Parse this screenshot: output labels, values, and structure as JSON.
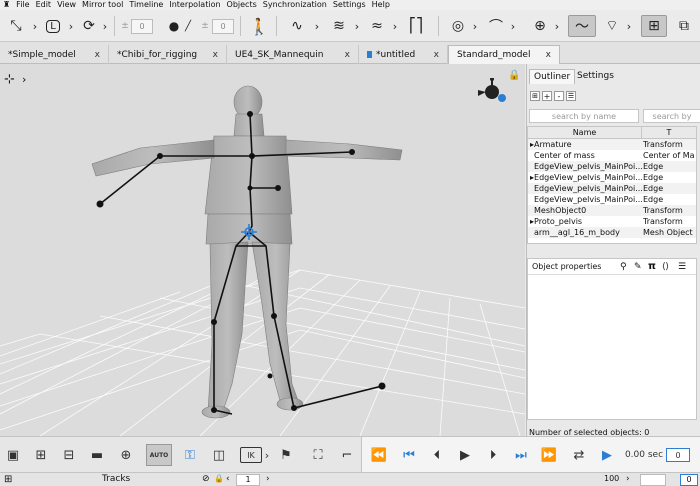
{
  "menu": {
    "items": [
      "File",
      "Edit",
      "View",
      "Mirror tool",
      "Timeline",
      "Interpolation",
      "Objects",
      "Synchronization",
      "Settings",
      "Help"
    ]
  },
  "toolbar": {
    "spin1_value": "0",
    "spin2_value": "0"
  },
  "tabs": [
    {
      "label": "*Simple_model",
      "close": "x"
    },
    {
      "label": "*Chibi_for_rigging",
      "close": "x"
    },
    {
      "label": "UE4_SK_Mannequin",
      "close": "x"
    },
    {
      "label": "*untitled",
      "close": "x"
    },
    {
      "label": "Standard_model",
      "close": "x"
    }
  ],
  "panel": {
    "tab_outliner": "Outliner",
    "tab_settings": "Settings",
    "search_name_placeholder": "search by name",
    "search_type_placeholder": "search by",
    "col_name": "Name",
    "col_type": "T",
    "rows": [
      {
        "name": "Armature",
        "type": "Transform",
        "expand": "▸"
      },
      {
        "name": "Center of mass",
        "type": "Center of Ma",
        "expand": ""
      },
      {
        "name": "EdgeView_pelvis_MainPoi...",
        "type": "Edge",
        "expand": ""
      },
      {
        "name": "EdgeView_pelvis_MainPoi...",
        "type": "Edge",
        "expand": "▸"
      },
      {
        "name": "EdgeView_pelvis_MainPoi...",
        "type": "Edge",
        "expand": ""
      },
      {
        "name": "EdgeView_pelvis_MainPoi...",
        "type": "Edge",
        "expand": ""
      },
      {
        "name": "MeshObject0",
        "type": "Transform",
        "expand": ""
      },
      {
        "name": "Proto_pelvis",
        "type": "Transform",
        "expand": "▸"
      },
      {
        "name": "arm__agl_16_m_body",
        "type": "Mesh Object",
        "expand": ""
      }
    ],
    "obj_props_title": "Object properties",
    "obj_props_pi": "π",
    "selected_count_text": "Number of selected objects: 0"
  },
  "bottom": {
    "auto_label": "AUTO",
    "ik_label": "IK",
    "time_text": "0.00 sec",
    "frame_value": "0"
  },
  "status": {
    "tracks_label": "Tracks",
    "frame_current": "1",
    "frame_end": "100",
    "field_right": "0"
  },
  "colors": {
    "accent": "#2a7fd4",
    "viewport_bg": "#dcdcdc",
    "grid": "#ffffff"
  }
}
